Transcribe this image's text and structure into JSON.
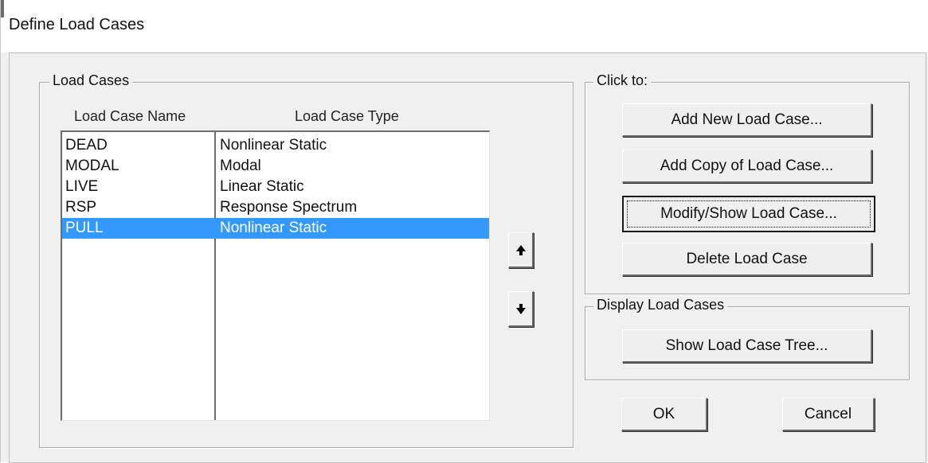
{
  "window": {
    "title": "Define Load Cases"
  },
  "load_cases_group": {
    "legend": "Load Cases",
    "columns": {
      "name": "Load Case Name",
      "type": "Load Case Type"
    },
    "rows": [
      {
        "name": "DEAD",
        "type": "Nonlinear Static",
        "selected": false
      },
      {
        "name": "MODAL",
        "type": "Modal",
        "selected": false
      },
      {
        "name": "LIVE",
        "type": "Linear Static",
        "selected": false
      },
      {
        "name": "RSP",
        "type": "Response Spectrum",
        "selected": false
      },
      {
        "name": "PULL",
        "type": "Nonlinear Static",
        "selected": true
      }
    ],
    "move_up_icon": "arrow-up-icon",
    "move_down_icon": "arrow-down-icon"
  },
  "click_to_group": {
    "legend": "Click to:",
    "add_new": "Add New Load Case...",
    "add_copy": "Add Copy of Load Case...",
    "modify_show": "Modify/Show Load Case...",
    "delete": "Delete Load Case"
  },
  "display_group": {
    "legend": "Display Load Cases",
    "show_tree": "Show Load Case Tree..."
  },
  "footer": {
    "ok": "OK",
    "cancel": "Cancel"
  },
  "colors": {
    "selection": "#3399ff",
    "dialog_bg": "#f0f0f0"
  }
}
